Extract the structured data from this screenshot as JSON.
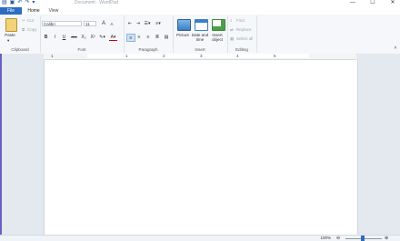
{
  "window": {
    "title": "Document - WordPad"
  },
  "quick_access": {
    "icons": [
      "app-icon",
      "save-icon",
      "undo-icon",
      "redo-icon",
      "chevron-down-icon"
    ]
  },
  "window_controls": {
    "minimize": "—",
    "maximize": "☐",
    "close": "✕"
  },
  "tabs": {
    "file": "File",
    "home": "Home",
    "view": "View"
  },
  "ribbon": {
    "clipboard": {
      "label": "Clipboard",
      "paste": "Paste",
      "cut": "Cut",
      "copy": "Copy"
    },
    "font": {
      "label": "Font",
      "family": "Calibri",
      "size": "11",
      "bold": "B",
      "italic": "I",
      "underline": "U",
      "strike": "abc",
      "sub": "X₂",
      "sup": "X²",
      "grow": "A",
      "shrink": "A"
    },
    "paragraph": {
      "label": "Paragraph"
    },
    "insert": {
      "label": "Insert",
      "picture": "Picture",
      "datetime_1": "Date and",
      "datetime_2": "time",
      "object_1": "Insert",
      "object_2": "object"
    },
    "editing": {
      "label": "Editing",
      "find": "Find",
      "replace": "Replace",
      "select_all": "Select all"
    }
  },
  "ruler": {
    "numbers": [
      "1",
      "1",
      "2",
      "3",
      "4",
      "5"
    ]
  },
  "status": {
    "zoom": "100%",
    "zoom_out": "⊖",
    "zoom_in": "⊕"
  },
  "colors": {
    "accent": "#2b6cc4",
    "ribbon_bg": "#f5f7fa",
    "page": "#ffffff"
  }
}
